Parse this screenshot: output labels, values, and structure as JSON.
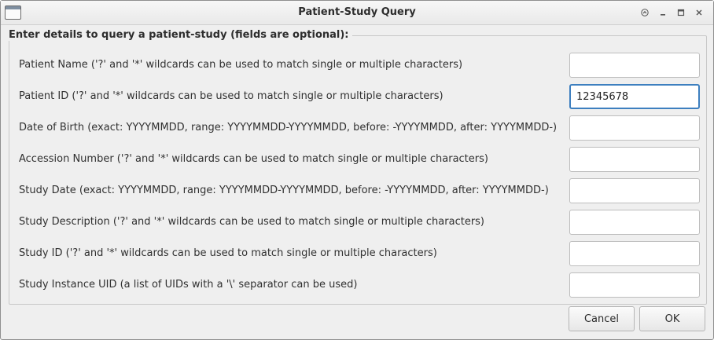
{
  "window": {
    "title": "Patient-Study Query"
  },
  "group": {
    "title": "Enter details to query a patient-study (fields are optional):"
  },
  "fields": [
    {
      "label": "Patient Name ('?' and '*' wildcards can be used to match single or multiple characters)",
      "value": ""
    },
    {
      "label": "Patient ID ('?' and '*' wildcards can be used to match single or multiple characters)",
      "value": "12345678"
    },
    {
      "label": "Date of Birth (exact: YYYYMMDD, range: YYYYMMDD-YYYYMMDD, before: -YYYYMMDD, after: YYYYMMDD-)",
      "value": ""
    },
    {
      "label": "Accession Number ('?' and '*' wildcards can be used to match single or multiple characters)",
      "value": ""
    },
    {
      "label": "Study Date (exact: YYYYMMDD, range: YYYYMMDD-YYYYMMDD, before: -YYYYMMDD, after: YYYYMMDD-)",
      "value": ""
    },
    {
      "label": "Study Description ('?' and '*' wildcards can be used to match single or multiple characters)",
      "value": ""
    },
    {
      "label": "Study ID ('?' and '*' wildcards can be used to match single or multiple characters)",
      "value": ""
    },
    {
      "label": "Study Instance UID (a list of UIDs with a '\\' separator can be used)",
      "value": ""
    }
  ],
  "buttons": {
    "cancel": "Cancel",
    "ok": "OK"
  },
  "icons": {
    "app": "window-icon",
    "shade": "shade-up-icon",
    "minimize": "minimize-icon",
    "maximize": "maximize-icon",
    "close": "close-icon"
  },
  "colors": {
    "focus_border": "#3d7fbf",
    "dialog_bg": "#efefef"
  }
}
